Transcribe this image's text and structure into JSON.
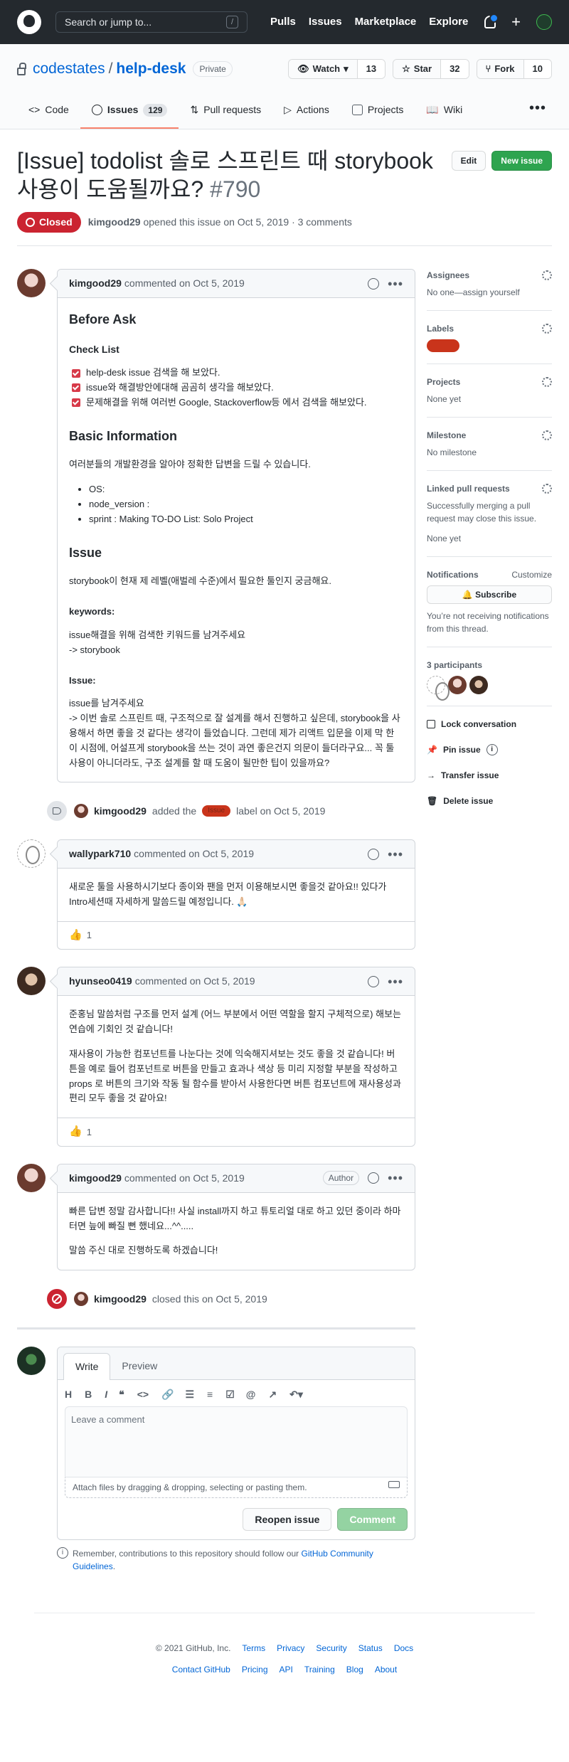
{
  "topnav": {
    "search_placeholder": "Search or jump to...",
    "search_key": "/",
    "links": [
      "Pulls",
      "Issues",
      "Marketplace",
      "Explore"
    ],
    "plus": "+"
  },
  "repo": {
    "owner": "codestates",
    "sep": "/",
    "name": "help-desk",
    "visibility": "Private",
    "watch": {
      "label": "Watch",
      "count": "13"
    },
    "star": {
      "label": "Star",
      "count": "32"
    },
    "fork": {
      "label": "Fork",
      "count": "10"
    }
  },
  "tabs": [
    {
      "label": "Code"
    },
    {
      "label": "Issues",
      "count": "129"
    },
    {
      "label": "Pull requests"
    },
    {
      "label": "Actions"
    },
    {
      "label": "Projects"
    },
    {
      "label": "Wiki"
    }
  ],
  "issue": {
    "title": "[Issue] todolist 솔로 스프린트 때 storybook 사용이 도움될까요?",
    "number": "#790",
    "edit": "Edit",
    "new_issue": "New issue",
    "state": "Closed",
    "author": "kimgood29",
    "opened_text": "opened this issue on Oct 5, 2019 · 3 comments"
  },
  "comments": [
    {
      "author": "kimgood29",
      "meta": "commented on Oct 5, 2019",
      "h_before": "Before Ask",
      "h_checklist": "Check List",
      "tasks": [
        "help-desk issue 검색을 해 보았다.",
        "issue와 해결방안에대해 곰곰히 생각을 해보았다.",
        "문제해결을 위해 여러번 Google, Stackoverflow등 에서 검색을 해보았다."
      ],
      "h_basic": "Basic Information",
      "basic_p": "여러분들의 개발환경을 알아야 정확한 답변을 드릴 수 있습니다.",
      "basic_list": [
        "OS:",
        "node_version :",
        "sprint : Making TO-DO List: Solo Project"
      ],
      "h_issue": "Issue",
      "issue_p": "storybook이 현재 제 레벨(애벌레 수준)에서 필요한 툴인지 궁금해요.",
      "h_keywords": "keywords:",
      "keywords_p1": "issue해결을 위해 검색한 키워드를 남겨주세요",
      "keywords_p2": "-> storybook",
      "h_issue2": "Issue:",
      "issue2_p1": "issue를 남겨주세요",
      "issue2_p2": "-> 이번 솔로 스프린트 때, 구조적으로 잘 설계를 해서 진행하고 싶은데, storybook을 사용해서 하면 좋을 것 같다는 생각이 들었습니다. 그런데 제가 리액트 입문을 이제 막 한 이 시점에, 어설프게 storybook을 쓰는 것이 과연 좋은건지 의문이 들더라구요... 꼭 툴 사용이 아니더라도, 구조 설계를 할 때 도움이 될만한 팁이 있을까요?"
    },
    {
      "author": "wallypark710",
      "meta": "commented on Oct 5, 2019",
      "body": "새로운 툴을 사용하시기보다 종이와 팬을 먼저 이용해보시면 좋을것 같아요!! 있다가 Intro세션때 자세하게 말씀드릴 예정입니다. 🙏🏻",
      "reaction": "👍",
      "reaction_count": "1"
    },
    {
      "author": "hyunseo0419",
      "meta": "commented on Oct 5, 2019",
      "p1": "준홍님 말씀처럼 구조를 먼저 설계 (어느 부분에서 어떤 역할을 할지 구체적으로) 해보는 연습에 기회인 것 같습니다!",
      "p2": "재사용이 가능한 컴포넌트를 나눈다는 것에 익숙해지셔보는 것도 좋을 것 같습니다! 버튼을 예로 들어 컴포넌트로 버튼을 만들고 효과나 색상 등 미리 지정할 부분을 작성하고 props 로 버튼의 크기와 작동 될 함수를 받아서 사용한다면 버튼 컴포넌트에 재사용성과 편리 모두 좋을 것 같아요!",
      "reaction": "👍",
      "reaction_count": "1"
    },
    {
      "author": "kimgood29",
      "meta": "commented on Oct 5, 2019",
      "badge": "Author",
      "p1": "빠른 답변 정말 감사합니다!! 사실 install까지 하고 튜토리얼 대로 하고 있던 중이라 하마터면 늪에 빠질 뻔 했네요...^^.....",
      "p2": "말씀 주신 대로 진행하도록 하겠습니다!"
    }
  ],
  "events": {
    "label_user": "kimgood29",
    "label_pre": "added the",
    "label_name": "Issue",
    "label_post": "label on Oct 5, 2019",
    "closed_user": "kimgood29",
    "closed_text": "closed this on Oct 5, 2019"
  },
  "editor": {
    "tab_write": "Write",
    "tab_preview": "Preview",
    "tools": [
      "H",
      "B",
      "I"
    ],
    "placeholder": "Leave a comment",
    "attach": "Attach files by dragging & dropping, selecting or pasting them.",
    "reopen": "Reopen issue",
    "comment": "Comment",
    "remember_pre": "Remember, contributions to this repository should follow our",
    "remember_link": "GitHub Community Guidelines",
    "remember_post": "."
  },
  "sidebar": {
    "assignees": "Assignees",
    "assignees_val": "No one—assign yourself",
    "labels": "Labels",
    "projects": "Projects",
    "projects_val": "None yet",
    "milestone": "Milestone",
    "milestone_val": "No milestone",
    "linked": "Linked pull requests",
    "linked_desc": "Successfully merging a pull request may close this issue.",
    "linked_val": "None yet",
    "notifications": "Notifications",
    "customize": "Customize",
    "subscribe": "Subscribe",
    "notif_desc": "You’re not receiving notifications from this thread.",
    "participants": "3 participants",
    "lock": "Lock conversation",
    "pin": "Pin issue",
    "transfer": "Transfer issue",
    "delete": "Delete issue"
  },
  "footer": {
    "copyright": "© 2021 GitHub, Inc.",
    "row1": [
      "Terms",
      "Privacy",
      "Security",
      "Status",
      "Docs"
    ],
    "row2": [
      "Contact GitHub",
      "Pricing",
      "API",
      "Training",
      "Blog",
      "About"
    ]
  },
  "colors": {
    "accent": "#0366d6",
    "closed": "#cb2431",
    "label": "#c9341b",
    "green": "#2ea44f"
  }
}
